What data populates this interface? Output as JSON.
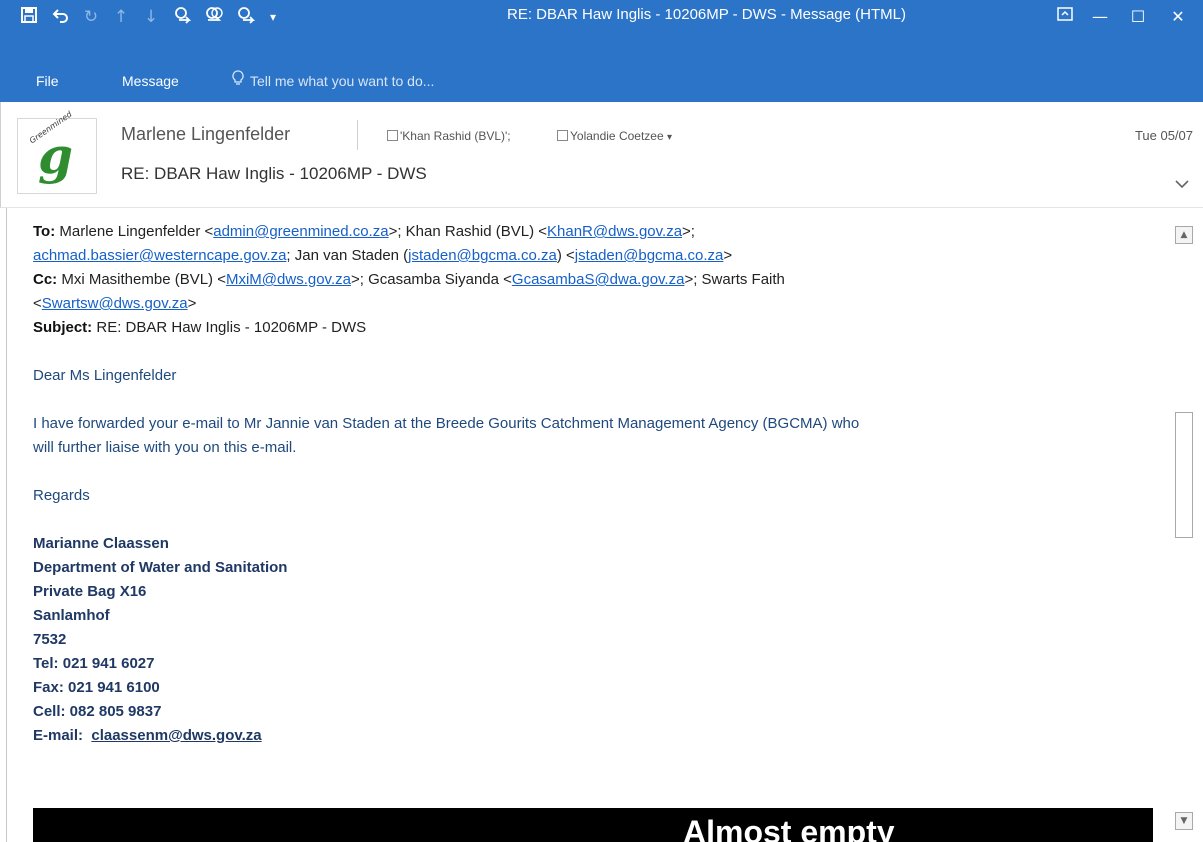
{
  "window": {
    "title": "RE: DBAR Haw Inglis - 10206MP - DWS - Message (HTML)",
    "accent_color": "#2b74c7"
  },
  "quick_access": [
    {
      "icon": "save-icon",
      "glyph": "🖫"
    },
    {
      "icon": "undo-icon",
      "glyph": "↶"
    },
    {
      "icon": "redo-icon",
      "glyph": "↻"
    },
    {
      "icon": "previous-item-icon",
      "glyph": "↑"
    },
    {
      "icon": "next-item-icon",
      "glyph": "↓"
    },
    {
      "icon": "reply-icon",
      "glyph": "⍈"
    },
    {
      "icon": "reply-all-icon",
      "glyph": "⍈"
    },
    {
      "icon": "forward-icon",
      "glyph": "⍈"
    },
    {
      "icon": "customize-dropdown-icon",
      "glyph": "▾"
    }
  ],
  "window_controls": {
    "restore_ribbon": "⊡",
    "minimize": "—",
    "maximize": "☐",
    "close": "✕"
  },
  "ribbon": {
    "tabs": [
      "File",
      "Message"
    ],
    "tell_me": "Tell me what you want to do..."
  },
  "header": {
    "sender": "Marlene Lingenfelder",
    "recipients": [
      "'Khan Rashid (BVL)';",
      "Yolandie Coetzee"
    ],
    "date": "Tue 05/07",
    "subject": "RE: DBAR Haw Inglis - 10206MP - DWS",
    "avatar_text": "Greenmined"
  },
  "message": {
    "to_label": "To:",
    "to_line1_a": "Marlene Lingenfelder <",
    "to_link1": "admin@greenmined.co.za",
    "to_line1_b": ">; Khan Rashid (BVL) <",
    "to_link2": "KhanR@dws.gov.za",
    "to_line1_c": ">;",
    "to_link3": "achmad.bassier@westerncape.gov.za",
    "to_line2_a": "; Jan van Staden (",
    "to_link4": "jstaden@bgcma.co.za",
    "to_line2_b": ") <",
    "to_link5": "jstaden@bgcma.co.za",
    "to_line2_c": ">",
    "cc_label": "Cc:",
    "cc_line_a": "Mxi Masithembe (BVL) <",
    "cc_link1": "MxiM@dws.gov.za",
    "cc_line_b": ">; Gcasamba Siyanda <",
    "cc_link2": "GcasambaS@dwa.gov.za",
    "cc_line_c": ">; Swarts Faith",
    "cc_line_d": "<",
    "cc_link3": "Swartsw@dws.gov.za",
    "cc_line_e": ">",
    "subject_label": "Subject:",
    "subject": "RE: DBAR Haw Inglis - 10206MP - DWS",
    "greeting": "Dear Ms Lingenfelder",
    "para1_line1": "I have forwarded your e-mail to Mr Jannie van Staden at the Breede Gourits Catchment Management Agency (BGCMA) who",
    "para1_line2": "will further liaise with you on this e-mail.",
    "regards": "Regards",
    "signature": {
      "name": "Marianne Claassen",
      "department": "Department of Water and Sanitation",
      "address1": "Private Bag X16",
      "address2": "Sanlamhof",
      "postal": "7532",
      "tel": "Tel:  021 941 6027",
      "fax": "Fax:  021 941 6100",
      "cell": "Cell:  082 805 9837",
      "email_label": "E-mail:",
      "email": "claassenm@dws.gov.za"
    },
    "banner_text": "Almost empty"
  }
}
